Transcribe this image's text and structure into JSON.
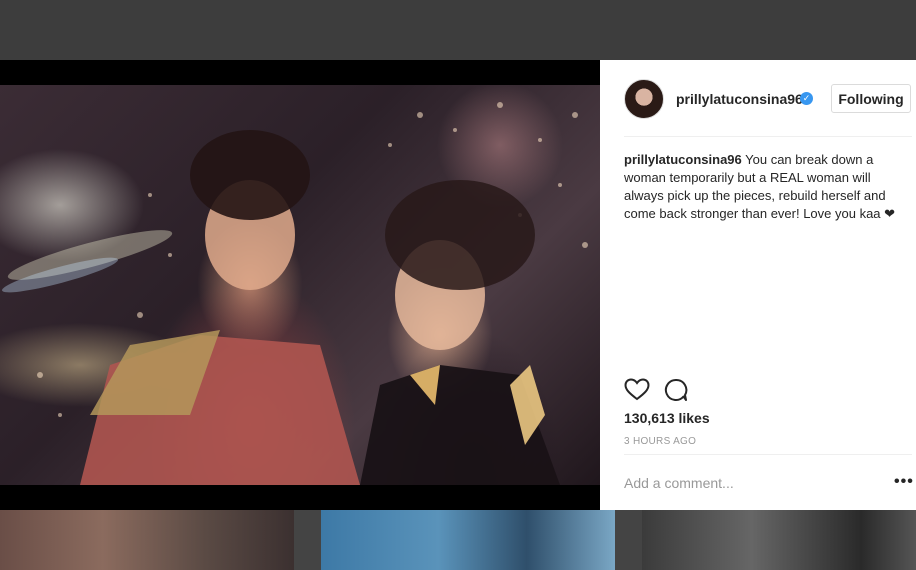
{
  "post": {
    "username": "prillylatuconsina96",
    "verified_icon": "verified-badge-icon",
    "follow_label": "Following",
    "caption_user": "prillylatuconsina96",
    "caption_text": "You can break down a woman temporarily but a REAL woman will always pick up the pieces, rebuild herself and come back stronger than ever! Love you kaa ❤",
    "likes": "130,613 likes",
    "timestamp": "3 HOURS AGO",
    "comment_placeholder": "Add a comment...",
    "more_icon": "more-options-icon"
  },
  "colors": {
    "verified": "#3897f0",
    "text": "#262626",
    "muted": "#999999",
    "backdrop": "#3a3a3a"
  }
}
